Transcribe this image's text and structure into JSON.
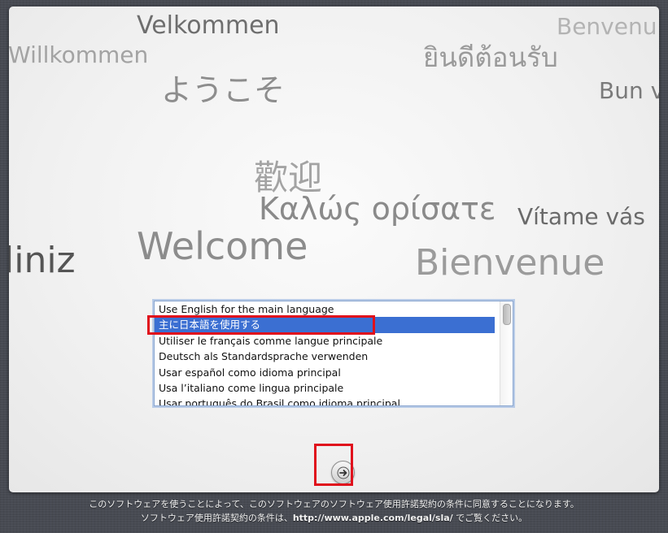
{
  "greetings": {
    "velkommen": "Velkommen",
    "willkommen": "Willkommen",
    "benvenuto": "Benvenu",
    "thai": "ยินดีต้อนรับ",
    "youkoso": "ようこそ",
    "bun": "Bun v",
    "huanying": "歡迎",
    "greek": "Καλώς ορίσατε",
    "vitame": "Vítame vás",
    "iniz": "liniz",
    "welcome": "Welcome",
    "bienvenue": "Bienvenue"
  },
  "language_list": {
    "selected_index": 1,
    "items": [
      "Use English for the main language",
      "主に日本語を使用する",
      "Utiliser le français comme langue principale",
      "Deutsch als Standardsprache verwenden",
      "Usar español como idioma principal",
      "Usa l’italiano come lingua principale",
      "Usar português do Brasil como idioma principal"
    ]
  },
  "continue_button": {
    "icon": "arrow-right-icon"
  },
  "footer": {
    "line1": "このソフトウェアを使うことによって、このソフトウェアのソフトウェア使用許諾契約の条件に同意することになります。",
    "line2_prefix": "ソフトウェア使用許諾契約の条件は、",
    "line2_url": "http://www.apple.com/legal/sla/",
    "line2_suffix": " でご覧ください。"
  },
  "colors": {
    "selection": "#3b6fd2",
    "highlight_annotation": "#e0101c",
    "background": "#474a52"
  }
}
